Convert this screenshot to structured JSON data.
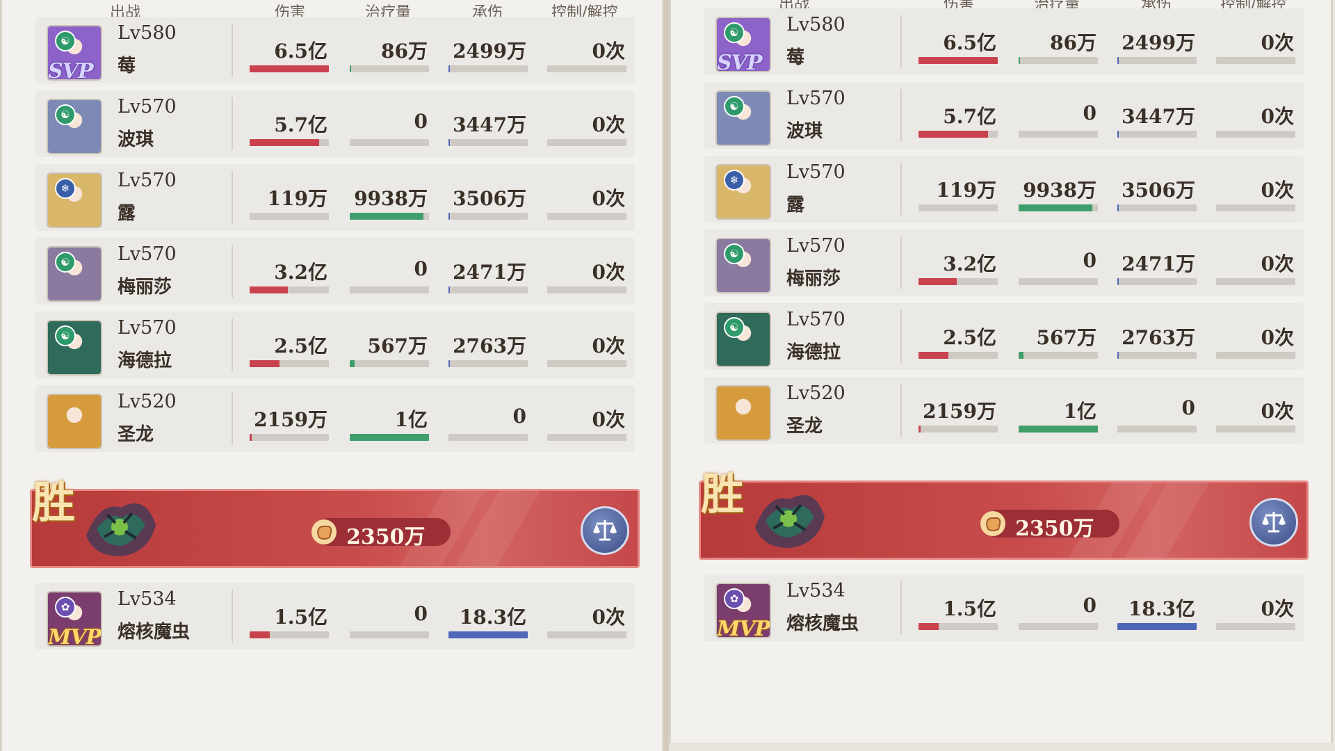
{
  "headers": {
    "team": "出战",
    "damage": "伤害",
    "heal": "治疗量",
    "taken": "承伤",
    "control": "控制/解控"
  },
  "rows": [
    {
      "level": "Lv580",
      "name": "莓",
      "damage": "6.5亿",
      "heal": "86万",
      "taken": "2499万",
      "control": "0次",
      "damage_pct": 100,
      "heal_pct": 1,
      "taken_pct": 1,
      "control_pct": 0,
      "badge": "green",
      "tag": "SVP",
      "color": "#8d63c9"
    },
    {
      "level": "Lv570",
      "name": "波琪",
      "damage": "5.7亿",
      "heal": "0",
      "taken": "3447万",
      "control": "0次",
      "damage_pct": 88,
      "heal_pct": 0,
      "taken_pct": 2,
      "control_pct": 0,
      "badge": "green",
      "tag": "",
      "color": "#7d8ab5"
    },
    {
      "level": "Lv570",
      "name": "露",
      "damage": "119万",
      "heal": "9938万",
      "taken": "3506万",
      "control": "0次",
      "damage_pct": 0,
      "heal_pct": 93,
      "taken_pct": 2,
      "control_pct": 0,
      "badge": "blue",
      "tag": "",
      "color": "#d8b76a"
    },
    {
      "level": "Lv570",
      "name": "梅丽莎",
      "damage": "3.2亿",
      "heal": "0",
      "taken": "2471万",
      "control": "0次",
      "damage_pct": 48,
      "heal_pct": 0,
      "taken_pct": 1,
      "control_pct": 0,
      "badge": "green",
      "tag": "",
      "color": "#8a7a9f"
    },
    {
      "level": "Lv570",
      "name": "海德拉",
      "damage": "2.5亿",
      "heal": "567万",
      "taken": "2763万",
      "control": "0次",
      "damage_pct": 38,
      "heal_pct": 6,
      "taken_pct": 1,
      "control_pct": 0,
      "badge": "green",
      "tag": "",
      "color": "#2f6a5a"
    },
    {
      "level": "Lv520",
      "name": "圣龙",
      "damage": "2159万",
      "heal": "1亿",
      "taken": "0",
      "control": "0次",
      "damage_pct": 3,
      "heal_pct": 100,
      "taken_pct": 0,
      "control_pct": 0,
      "badge": "",
      "tag": "",
      "color": "#d59b3c"
    }
  ],
  "banner": {
    "result": "胜",
    "score": "2350万",
    "icon": "scales-icon"
  },
  "enemy": {
    "level": "Lv534",
    "name": "熔核魔虫",
    "damage": "1.5亿",
    "heal": "0",
    "taken": "18.3亿",
    "control": "0次",
    "damage_pct": 25,
    "heal_pct": 0,
    "taken_pct": 100,
    "control_pct": 0,
    "badge": "purple",
    "tag": "MVP",
    "color": "#7a3d6e"
  }
}
